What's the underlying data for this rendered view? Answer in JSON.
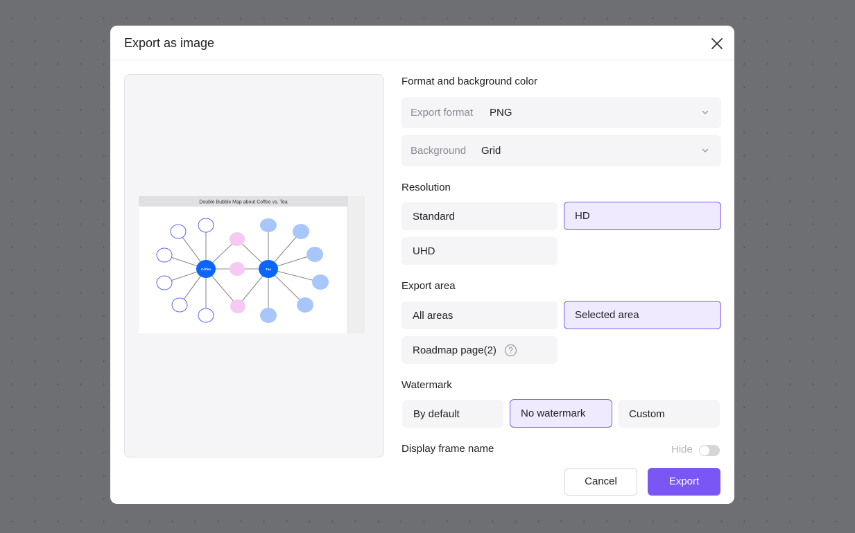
{
  "modal": {
    "title": "Export as image",
    "close_icon": "close-icon"
  },
  "preview": {
    "diagram_title": "Double Bubble Map about Coffee vs. Tea",
    "left_center": "Coffee",
    "right_center": "Tea",
    "colors": {
      "center": "#0a66ff",
      "left_outline": "#5b63f0",
      "shared_fill": "#f5c9f2",
      "right_fill": "#a9c6fb"
    }
  },
  "format": {
    "section_title": "Format and background color",
    "export_format_label": "Export format",
    "export_format_value": "PNG",
    "background_label": "Background",
    "background_value": "Grid"
  },
  "resolution": {
    "section_title": "Resolution",
    "options": [
      "Standard",
      "HD",
      "UHD"
    ],
    "selected": "HD"
  },
  "export_area": {
    "section_title": "Export area",
    "options": [
      "All areas",
      "Selected area",
      "Roadmap page(2)"
    ],
    "selected": "Selected area"
  },
  "watermark": {
    "section_title": "Watermark",
    "options": [
      "By default",
      "No watermark",
      "Custom"
    ],
    "selected": "No watermark"
  },
  "frame_name": {
    "label": "Display frame name",
    "toggle_label": "Hide",
    "enabled": false
  },
  "footer": {
    "cancel_label": "Cancel",
    "export_label": "Export"
  },
  "colors": {
    "accent": "#7a57f5",
    "selected_bg": "#efeafd"
  }
}
